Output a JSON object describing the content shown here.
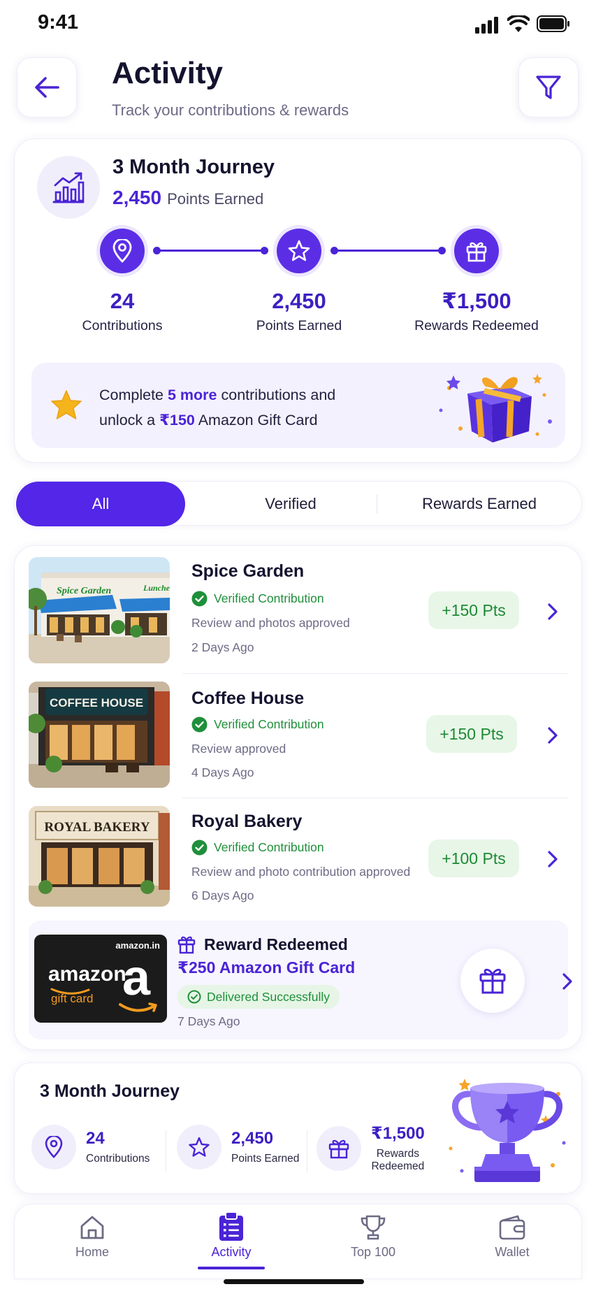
{
  "status_bar": {
    "time": "9:41"
  },
  "header": {
    "title": "Activity",
    "subtitle": "Track your contributions & rewards"
  },
  "journey": {
    "title": "3 Month Journey",
    "points_value": "2,450",
    "points_label": "Points Earned",
    "stats": [
      {
        "value": "24",
        "label": "Contributions",
        "icon": "location-pin-icon"
      },
      {
        "value": "2,450",
        "label": "Points Earned",
        "icon": "star-icon"
      },
      {
        "value": "₹1,500",
        "label": "Rewards Redeemed",
        "icon": "gift-icon"
      }
    ],
    "promo": {
      "part1": "Complete ",
      "highlight1": "5 more",
      "part2": " contributions and",
      "part3": "unlock a ",
      "highlight2": "₹150",
      "part4": " Amazon Gift Card"
    }
  },
  "filters": {
    "tabs": [
      {
        "label": "All",
        "active": true
      },
      {
        "label": "Verified",
        "active": false
      },
      {
        "label": "Rewards Earned",
        "active": false
      }
    ]
  },
  "activities": [
    {
      "title": "Spice Garden",
      "status": "Verified Contribution",
      "description": "Review and photos approved",
      "time": "2 Days Ago",
      "points": "+150 Pts",
      "sign_text": "Spice Garden",
      "sign_text2": "Lunches"
    },
    {
      "title": "Coffee House",
      "status": "Verified Contribution",
      "description": "Review approved",
      "time": "4 Days Ago",
      "points": "+150 Pts",
      "sign_text": "COFFEE HOUSE"
    },
    {
      "title": "Royal Bakery",
      "status": "Verified Contribution",
      "description": "Review and photo contribution approved",
      "time": "6 Days Ago",
      "points": "+100 Pts",
      "sign_text": "ROYAL BAKERY"
    }
  ],
  "reward": {
    "title": "Reward Redeemed",
    "amount": "₹250 Amazon Gift Card",
    "status": "Delivered Successfully",
    "time": "7 Days Ago",
    "card_domain": "amazon.in",
    "card_brand": "amazon",
    "card_sub": "gift card",
    "card_letter": "a"
  },
  "summary": {
    "title": "3 Month Journey",
    "stats": [
      {
        "value": "24",
        "label": "Contributions"
      },
      {
        "value": "2,450",
        "label": "Points Earned"
      },
      {
        "value": "₹1,500",
        "label1": "Rewards",
        "label2": "Redeemed"
      }
    ]
  },
  "bottom_nav": {
    "items": [
      {
        "label": "Home",
        "icon": "home-icon",
        "active": false
      },
      {
        "label": "Activity",
        "icon": "clipboard-icon",
        "active": true
      },
      {
        "label": "Top 100",
        "icon": "trophy-icon",
        "active": false
      },
      {
        "label": "Wallet",
        "icon": "wallet-icon",
        "active": false
      }
    ]
  },
  "colors": {
    "accent": "#4a24d6",
    "success": "#1e8f3a",
    "success_bg": "#e8f6e8"
  }
}
